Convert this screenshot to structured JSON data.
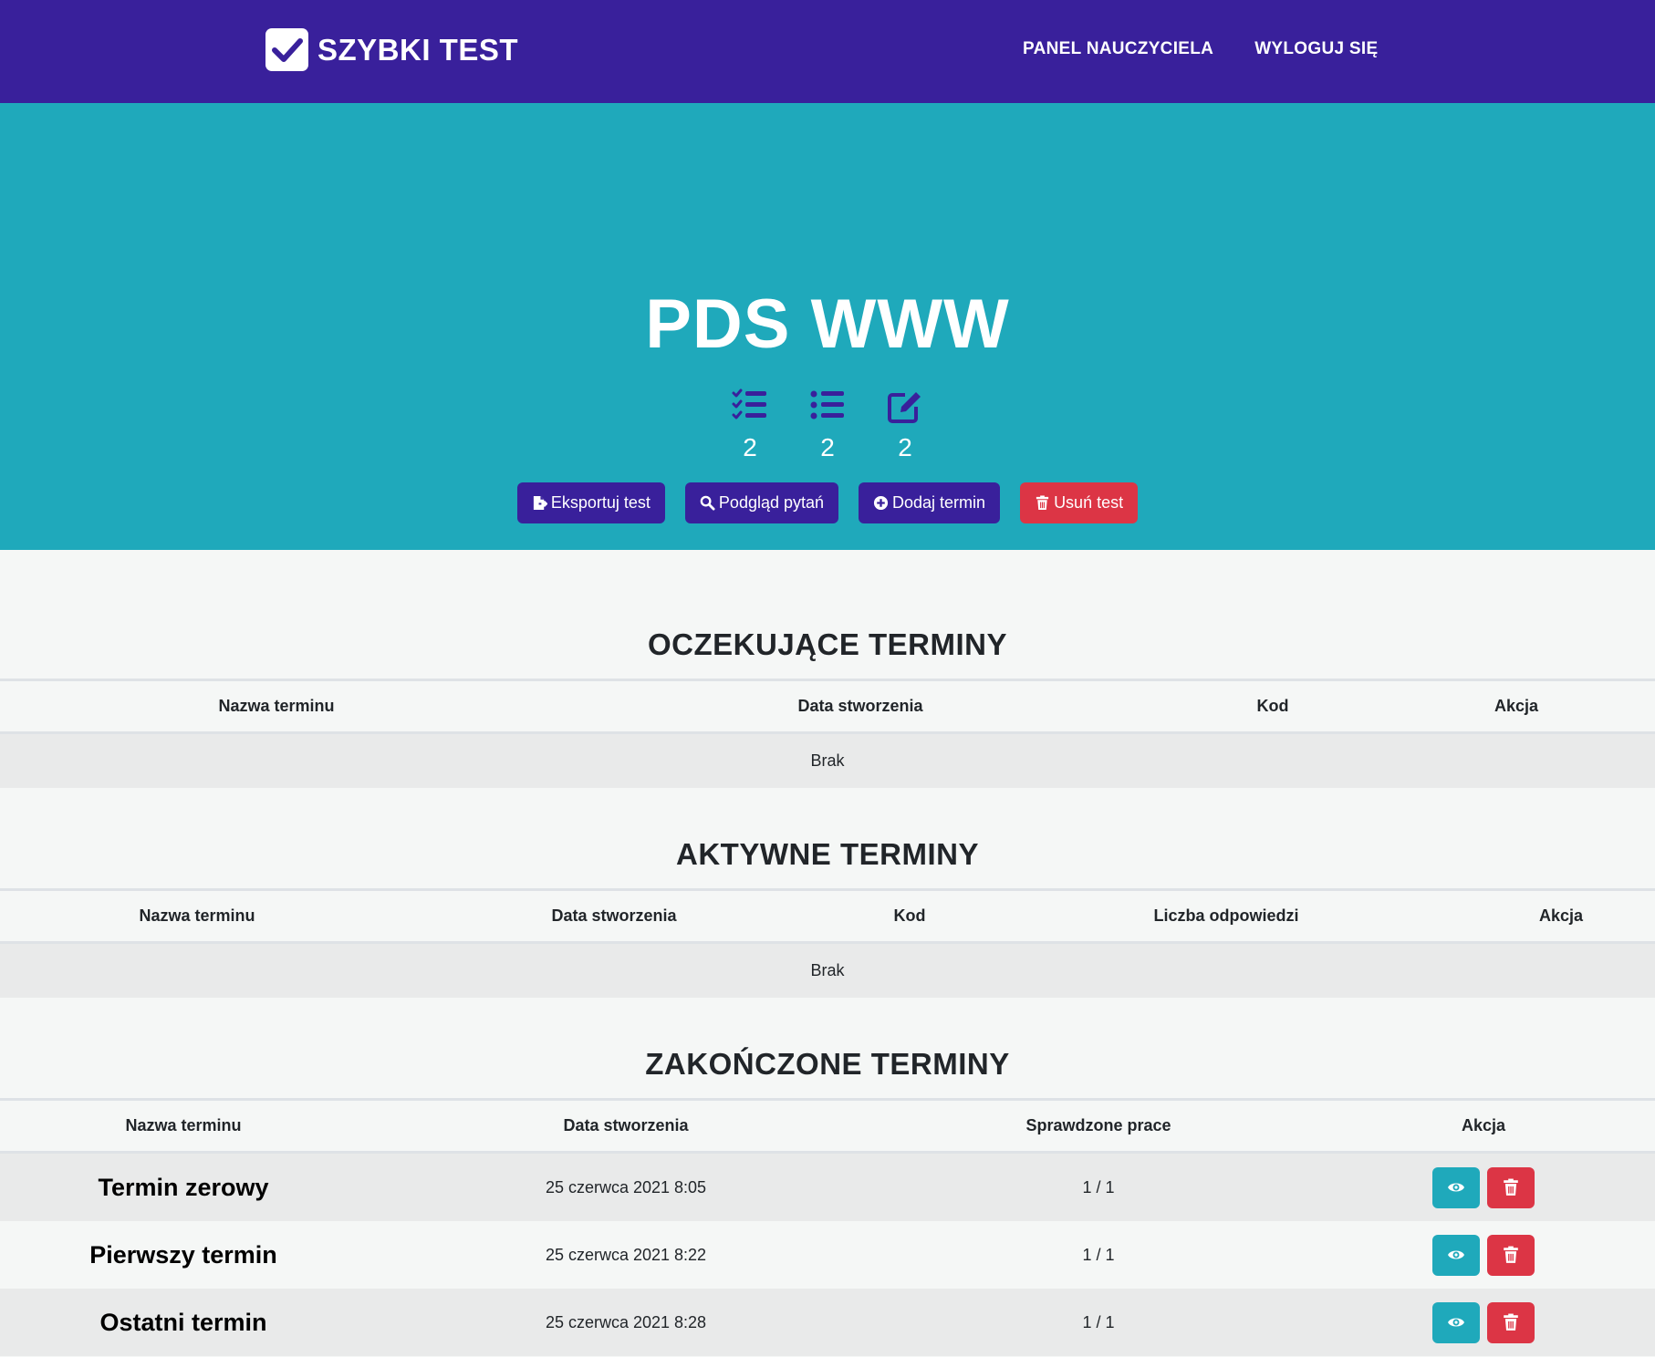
{
  "navbar": {
    "brand": "SZYBKI TEST",
    "links": [
      "PANEL NAUCZYCIELA",
      "WYLOGUJ SIĘ"
    ]
  },
  "hero": {
    "title": "PDS WWW",
    "stats": [
      {
        "icon": "tasks-icon",
        "value": "2"
      },
      {
        "icon": "list-icon",
        "value": "2"
      },
      {
        "icon": "edit-icon",
        "value": "2"
      }
    ],
    "buttons": {
      "export": "Eksportuj test",
      "preview": "Podgląd pytań",
      "add_term": "Dodaj termin",
      "delete": "Usuń test"
    }
  },
  "pending": {
    "title": "OCZEKUJĄCE TERMINY",
    "columns": [
      "Nazwa terminu",
      "Data stworzenia",
      "Kod",
      "Akcja"
    ],
    "empty": "Brak"
  },
  "active": {
    "title": "AKTYWNE TERMINY",
    "columns": [
      "Nazwa terminu",
      "Data stworzenia",
      "Kod",
      "Liczba odpowiedzi",
      "Akcja"
    ],
    "empty": "Brak"
  },
  "finished": {
    "title": "ZAKOŃCZONE TERMINY",
    "columns": [
      "Nazwa terminu",
      "Data stworzenia",
      "Sprawdzone prace",
      "Akcja"
    ],
    "rows": [
      {
        "name": "Termin zerowy",
        "date": "25 czerwca 2021 8:05",
        "checked": "1 / 1"
      },
      {
        "name": "Pierwszy termin",
        "date": "25 czerwca 2021 8:22",
        "checked": "1 / 1"
      },
      {
        "name": "Ostatni termin",
        "date": "25 czerwca 2021 8:28",
        "checked": "1 / 1"
      }
    ]
  },
  "colors": {
    "navbar": "#39209b",
    "hero": "#1fa9bb",
    "primary": "#39209b",
    "danger": "#dc3545",
    "info": "#1fa9bb"
  }
}
